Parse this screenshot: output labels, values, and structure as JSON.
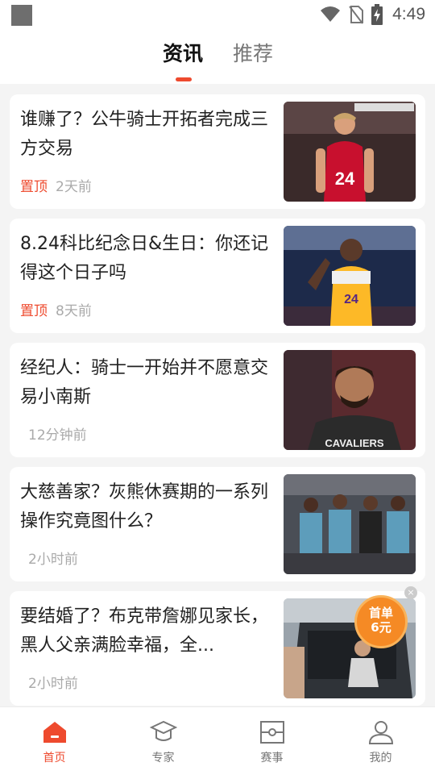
{
  "status_bar": {
    "time": "4:49"
  },
  "tabs": [
    {
      "label": "资讯",
      "active": true
    },
    {
      "label": "推荐",
      "active": false
    }
  ],
  "articles": [
    {
      "title": "谁赚了？公牛骑士开拓者完成三方交易",
      "pin": "置顶",
      "time": "2天前",
      "image": "bulls-player-photo"
    },
    {
      "title": "8.24科比纪念日&生日：你还记得这个日子吗",
      "pin": "置顶",
      "time": "8天前",
      "image": "lakers-player-photo"
    },
    {
      "title": "经纪人：骑士一开始并不愿意交易小南斯",
      "pin": "",
      "time": "12分钟前",
      "image": "cavaliers-player-photo"
    },
    {
      "title": "大慈善家？灰熊休赛期的一系列操作究竟图什么？",
      "pin": "",
      "time": "2小时前",
      "image": "grizzlies-team-photo"
    },
    {
      "title": "要结婚了？布克带詹娜见家长，黑人父亲满脸幸福，全...",
      "pin": "",
      "time": "2小时前",
      "image": "car-family-photo"
    }
  ],
  "promo": {
    "line1": "首单",
    "line2": "6元"
  },
  "bottom_nav": [
    {
      "label": "首页",
      "icon": "home-icon",
      "active": true
    },
    {
      "label": "专家",
      "icon": "graduation-cap-icon",
      "active": false
    },
    {
      "label": "赛事",
      "icon": "court-icon",
      "active": false
    },
    {
      "label": "我的",
      "icon": "user-icon",
      "active": false
    }
  ],
  "colors": {
    "accent": "#ee4a2e",
    "promo": "#f58a25",
    "background": "#f4f4f4"
  }
}
